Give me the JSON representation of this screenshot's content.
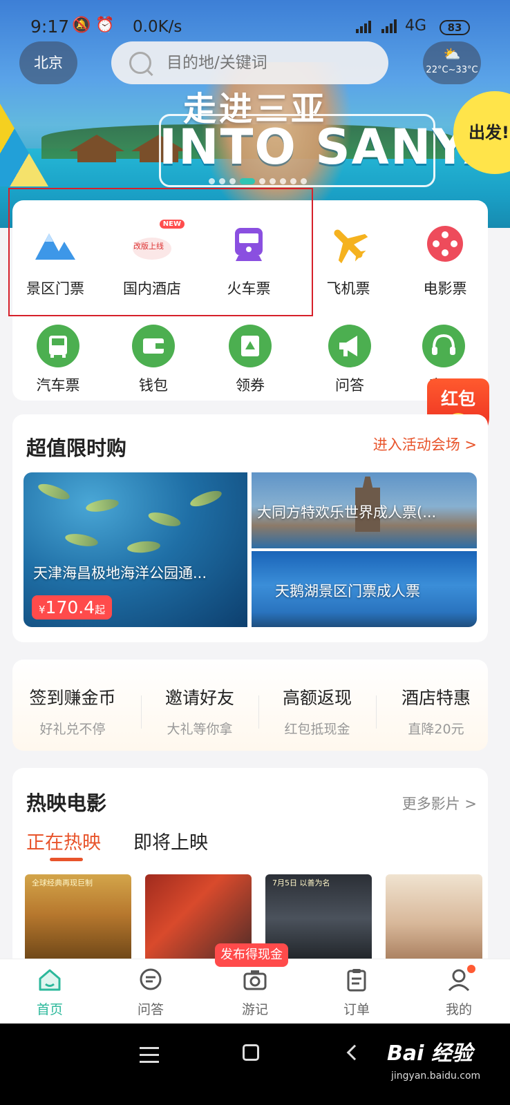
{
  "status_bar": {
    "time": "9:17",
    "net_speed": "0.0K/s",
    "network": "4G",
    "battery": "83"
  },
  "header": {
    "city": "北京",
    "search_placeholder": "目的地/关键词",
    "weather_temp": "22°C~33°C"
  },
  "banner": {
    "title_cn": "走进三亚",
    "title_en": "INTO SANYA",
    "badge": "出发!",
    "active_slide": 3,
    "slide_count": 9
  },
  "categories": {
    "row1": [
      {
        "label": "景区门票",
        "icon": "mountain-icon"
      },
      {
        "label": "国内酒店",
        "icon": "hotel-icon",
        "badge": "NEW",
        "icon_text": "改版上线"
      },
      {
        "label": "火车票",
        "icon": "train-icon"
      },
      {
        "label": "飞机票",
        "icon": "plane-icon"
      },
      {
        "label": "电影票",
        "icon": "film-reel-icon"
      }
    ],
    "row2": [
      {
        "label": "汽车票",
        "icon": "bus-icon"
      },
      {
        "label": "钱包",
        "icon": "wallet-icon"
      },
      {
        "label": "领券",
        "icon": "coupon-icon"
      },
      {
        "label": "问答",
        "icon": "megaphone-icon"
      },
      {
        "label": "客服",
        "icon": "headset-icon"
      }
    ]
  },
  "red_envelope": {
    "label": "红包",
    "coin": "¥"
  },
  "flash_sale": {
    "title": "超值限时购",
    "more": "进入活动会场 >",
    "items": [
      {
        "name": "天津海昌极地海洋公园通...",
        "price": "170.4",
        "currency": "¥",
        "suffix": "起"
      },
      {
        "name": "大同方特欢乐世界成人票(..."
      },
      {
        "name": "天鹅湖景区门票成人票"
      }
    ]
  },
  "activities": [
    {
      "title": "签到赚金币",
      "subtitle": "好礼兑不停"
    },
    {
      "title": "邀请好友",
      "subtitle": "大礼等你拿"
    },
    {
      "title": "高额返现",
      "subtitle": "红包抵现金"
    },
    {
      "title": "酒店特惠",
      "subtitle": "直降20元"
    }
  ],
  "movies": {
    "title": "热映电影",
    "more": "更多影片 >",
    "tabs": [
      "正在热映",
      "即将上映"
    ],
    "active_tab": 0,
    "poster_captions": [
      "全球经典再现巨制",
      "",
      "7月5日 以善为名",
      ""
    ]
  },
  "post_badge": "发布得现金",
  "tabbar": [
    {
      "label": "首页",
      "icon": "home-icon",
      "active": true
    },
    {
      "label": "问答",
      "icon": "chat-icon"
    },
    {
      "label": "游记",
      "icon": "camera-icon"
    },
    {
      "label": "订单",
      "icon": "clipboard-icon"
    },
    {
      "label": "我的",
      "icon": "user-icon",
      "dot": true
    }
  ],
  "watermark": {
    "text": "Bai 经验",
    "sub": "jingyan.baidu.com"
  },
  "colors": {
    "accent": "#2bb89b",
    "sale": "#e8542b",
    "highlight_box": "#d6202a"
  }
}
